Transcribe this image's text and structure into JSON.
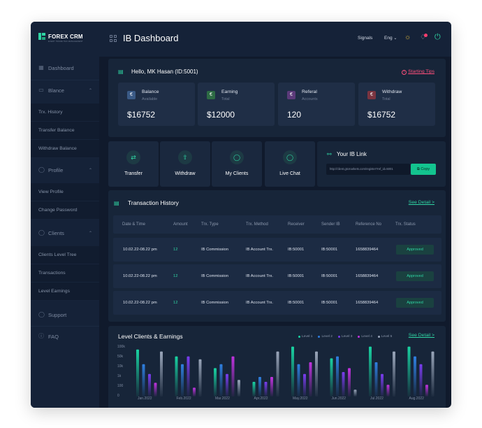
{
  "brand": {
    "name": "FOREX CRM",
    "tagline": "EVERY TRADE HAS MANAGEMENT"
  },
  "sidebar": {
    "items": [
      {
        "label": "Dashboard",
        "icon": "grid-icon"
      },
      {
        "label": "Blance",
        "icon": "card-icon",
        "expanded": true,
        "children": [
          "Trx. History",
          "Transfer Balance",
          "Withdraw Balance"
        ]
      },
      {
        "label": "Profile",
        "icon": "user-icon",
        "expanded": true,
        "children": [
          "View Profile",
          "Change Password"
        ]
      },
      {
        "label": "Clients",
        "icon": "users-icon",
        "expanded": true,
        "children": [
          "Clients Level Tree",
          "Transactions",
          "Level Earnings"
        ]
      },
      {
        "label": "Support",
        "icon": "chat-icon"
      },
      {
        "label": "FAQ",
        "icon": "info-icon"
      }
    ]
  },
  "header": {
    "title": "IB Dashboard",
    "signals": "Signals",
    "language": "Eng"
  },
  "welcome": {
    "greeting": "Hello, MK Hasan (ID:5001)",
    "tips_link": "Starting Tips"
  },
  "stats": [
    {
      "label": "Balance",
      "sub": "Available",
      "value": "$16752",
      "color": "#3a5a86",
      "icon": "wallet-icon"
    },
    {
      "label": "Earning",
      "sub": "Total",
      "value": "$12000",
      "color": "#2d6b44",
      "icon": "coin-icon"
    },
    {
      "label": "Referal",
      "sub": "Accounts",
      "value": "120",
      "color": "#5b3a7a",
      "icon": "referral-icon"
    },
    {
      "label": "Withdraw",
      "sub": "Total",
      "value": "$16752",
      "color": "#7a3440",
      "icon": "withdraw-icon"
    }
  ],
  "actions": [
    {
      "label": "Transfer",
      "icon": "transfer-icon"
    },
    {
      "label": "Withdraw",
      "icon": "upload-icon"
    },
    {
      "label": "My Clients",
      "icon": "user-icon"
    },
    {
      "label": "Live Chat",
      "icon": "chat-icon"
    }
  ],
  "ib_link": {
    "title": "Your IB Link",
    "url": "http://client.gtcmarkets.com/register?ref_id=5001",
    "copy_label": "Copy"
  },
  "transactions": {
    "title": "Transaction History",
    "see_detail": "See Detail >",
    "columns": [
      "Date & Time",
      "Amount",
      "Trx. Type",
      "Trx. Method",
      "Receiver",
      "Sender IB",
      "Reference No",
      "Trx. Status"
    ],
    "rows": [
      [
        "10.02.22-08.22 pm",
        "12",
        "IB Commission",
        "IB Account Trx.",
        "IB:50001",
        "IB:50001",
        "1658839464",
        "Approved"
      ],
      [
        "10.02.22-08.22 pm",
        "12",
        "IB Commission",
        "IB Account Trx.",
        "IB:50001",
        "IB:50001",
        "1658839464",
        "Approved"
      ],
      [
        "10.02.22-08.22 pm",
        "12",
        "IB Commission",
        "IB Account Trx.",
        "IB:50001",
        "IB:50001",
        "1658839464",
        "Approved"
      ]
    ]
  },
  "chart_section": {
    "title": "Level Clients & Earnings",
    "see_detail": "See Detail >"
  },
  "chart_data": {
    "type": "bar",
    "title": "Level Clients & Earnings",
    "y_ticks": [
      "100k",
      "50k",
      "10k",
      "1k",
      "100",
      "0"
    ],
    "categories": [
      "Jan.2022",
      "Feb.2022",
      "Mar.2022",
      "Apr.2022",
      "May.2022",
      "Jun.2022",
      "Jul.2022",
      "Aug.2022"
    ],
    "legend_position": "top-right",
    "grid": false,
    "series": [
      {
        "name": "Level 1",
        "color": "#19d3a2",
        "values": [
          4.8,
          4.1,
          2.9,
          1.5,
          5.1,
          3.9,
          5.1,
          5.1
        ]
      },
      {
        "name": "Level 2",
        "color": "#2f7fe0",
        "values": [
          3.3,
          3.3,
          3.3,
          2.0,
          3.3,
          4.1,
          3.5,
          4.1
        ]
      },
      {
        "name": "Level 3",
        "color": "#7a3df0",
        "values": [
          2.3,
          4.1,
          2.3,
          1.5,
          2.3,
          2.5,
          2.3,
          3.3
        ]
      },
      {
        "name": "Level 4",
        "color": "#c233e0",
        "values": [
          1.4,
          0.9,
          4.1,
          2.0,
          3.5,
          2.9,
          1.2,
          1.2
        ]
      },
      {
        "name": "Level 5",
        "color": "#9aa6ba",
        "values": [
          4.6,
          3.8,
          1.7,
          4.6,
          4.6,
          0.7,
          4.6,
          4.6
        ]
      }
    ]
  }
}
